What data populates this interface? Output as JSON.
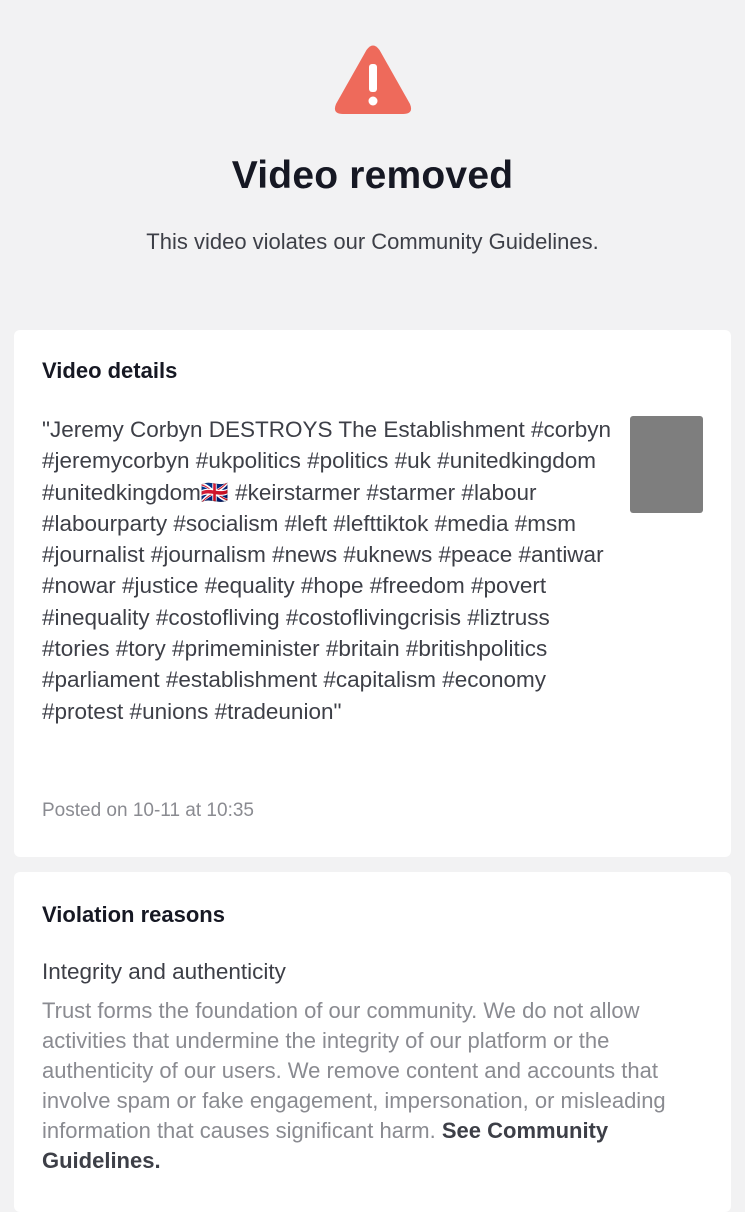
{
  "header": {
    "icon": "warning-triangle-icon",
    "icon_color": "#ee6a5b",
    "title": "Video removed",
    "subtitle": "This video violates our Community Guidelines."
  },
  "video_details": {
    "heading": "Video details",
    "caption": "\"Jeremy Corbyn DESTROYS The Establishment #corbyn #jeremycorbyn #ukpolitics #politics #uk #unitedkingdom #unitedkingdom🇬🇧 #keirstarmer #starmer #labour #labourparty #socialism #left #lefttiktok #media #msm #journalist #journalism #news #uknews #peace #antiwar #nowar #justice #equality #hope #freedom #povert #inequality #costofliving #costoflivingcrisis #liztruss #tories #tory #primeminister #britain #britishpolitics #parliament #establishment #capitalism #economy #protest #unions #tradeunion\"",
    "thumbnail_color": "#7e7e7e",
    "posted": "Posted on 10-11 at 10:35"
  },
  "violation": {
    "heading": "Violation reasons",
    "reason_title": "Integrity and authenticity",
    "reason_body": "Trust forms the foundation of our community. We do not allow activities that undermine the integrity of our platform or the authenticity of our users. We remove content and accounts that involve spam or fake engagement, impersonation, or misleading information that causes significant harm. ",
    "link_label": "See Community Guidelines."
  }
}
